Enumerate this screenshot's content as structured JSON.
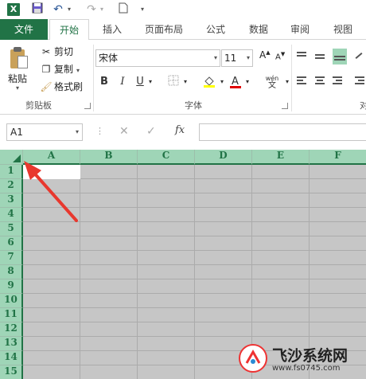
{
  "quick_access": {
    "app_icon": "X",
    "icons": [
      "save-icon",
      "undo-icon",
      "redo-icon",
      "new-document-icon",
      "customize-icon"
    ]
  },
  "tabs": [
    {
      "label": "文件"
    },
    {
      "label": "开始"
    },
    {
      "label": "插入"
    },
    {
      "label": "页面布局"
    },
    {
      "label": "公式"
    },
    {
      "label": "数据"
    },
    {
      "label": "审阅"
    },
    {
      "label": "视图"
    }
  ],
  "clipboard": {
    "paste": "粘贴",
    "cut": "剪切",
    "copy": "复制",
    "format_painter": "格式刷",
    "group_label": "剪贴板"
  },
  "font": {
    "name": "宋体",
    "size": "11",
    "bold": "B",
    "italic": "I",
    "underline": "U",
    "phonetic": "wén",
    "phonetic_sub": "文",
    "group_label": "字体",
    "font_color": "#e00000",
    "fill_color": "#ffff00"
  },
  "alignment": {
    "group_label_partial": "对"
  },
  "formula_bar": {
    "name_box": "A1",
    "fx": "fx",
    "formula": ""
  },
  "sheet": {
    "columns": [
      "A",
      "B",
      "C",
      "D",
      "E",
      "F"
    ],
    "rows": [
      "1",
      "2",
      "3",
      "4",
      "5",
      "6",
      "7",
      "8",
      "9",
      "10",
      "11",
      "12",
      "13",
      "14",
      "15"
    ],
    "selection": "all cells selected",
    "active_cell": "A1"
  },
  "watermark": {
    "title": "飞沙系统网",
    "url": "www.fs0745.com"
  },
  "colors": {
    "accent": "#217346",
    "header_selected": "#9fd5b7",
    "selection_fill": "#c6c6c6",
    "arrow": "#e8382e"
  }
}
